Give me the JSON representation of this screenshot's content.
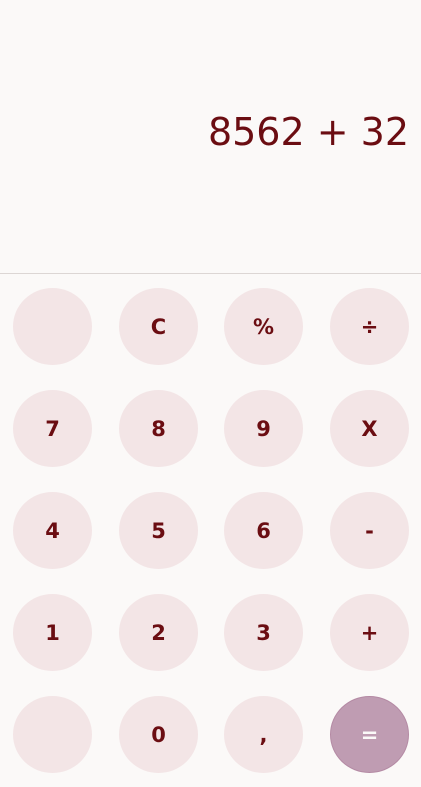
{
  "display": {
    "expression": "8562 + 32"
  },
  "keys": {
    "blank_top": "",
    "clear": "C",
    "percent": "%",
    "divide": "÷",
    "seven": "7",
    "eight": "8",
    "nine": "9",
    "multiply": "X",
    "four": "4",
    "five": "5",
    "six": "6",
    "minus": "-",
    "one": "1",
    "two": "2",
    "three": "3",
    "plus": "+",
    "blank_bottom": "",
    "zero": "0",
    "comma": ",",
    "equals": "="
  },
  "colors": {
    "background": "#fbf9f8",
    "key": "#f3e5e6",
    "key_text": "#6b0d12",
    "equals_key": "#bf9cb2"
  }
}
